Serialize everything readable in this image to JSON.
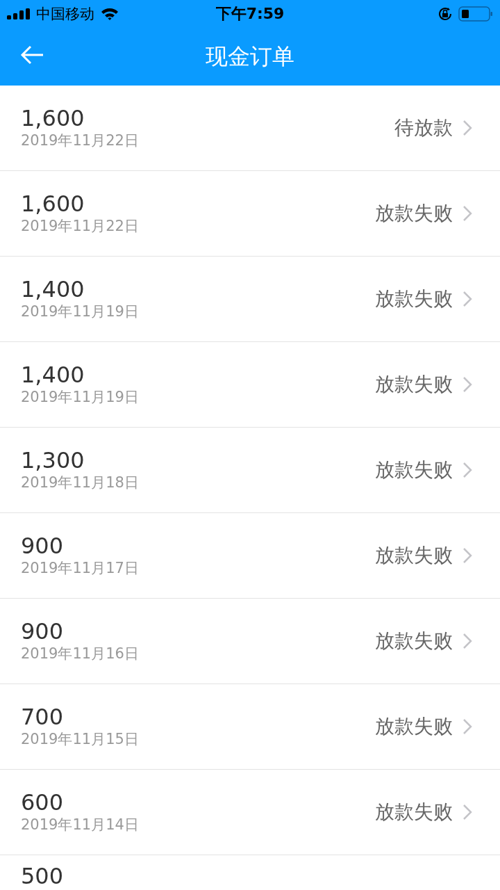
{
  "status_bar": {
    "carrier": "中国移动",
    "time": "下午7:59"
  },
  "nav": {
    "title": "现金订单"
  },
  "orders": [
    {
      "amount": "1,600",
      "date": "2019年11月22日",
      "status": "待放款"
    },
    {
      "amount": "1,600",
      "date": "2019年11月22日",
      "status": "放款失败"
    },
    {
      "amount": "1,400",
      "date": "2019年11月19日",
      "status": "放款失败"
    },
    {
      "amount": "1,400",
      "date": "2019年11月19日",
      "status": "放款失败"
    },
    {
      "amount": "1,300",
      "date": "2019年11月18日",
      "status": "放款失败"
    },
    {
      "amount": "900",
      "date": "2019年11月17日",
      "status": "放款失败"
    },
    {
      "amount": "900",
      "date": "2019年11月16日",
      "status": "放款失败"
    },
    {
      "amount": "700",
      "date": "2019年11月15日",
      "status": "放款失败"
    },
    {
      "amount": "600",
      "date": "2019年11月14日",
      "status": "放款失败"
    },
    {
      "amount": "500"
    }
  ]
}
